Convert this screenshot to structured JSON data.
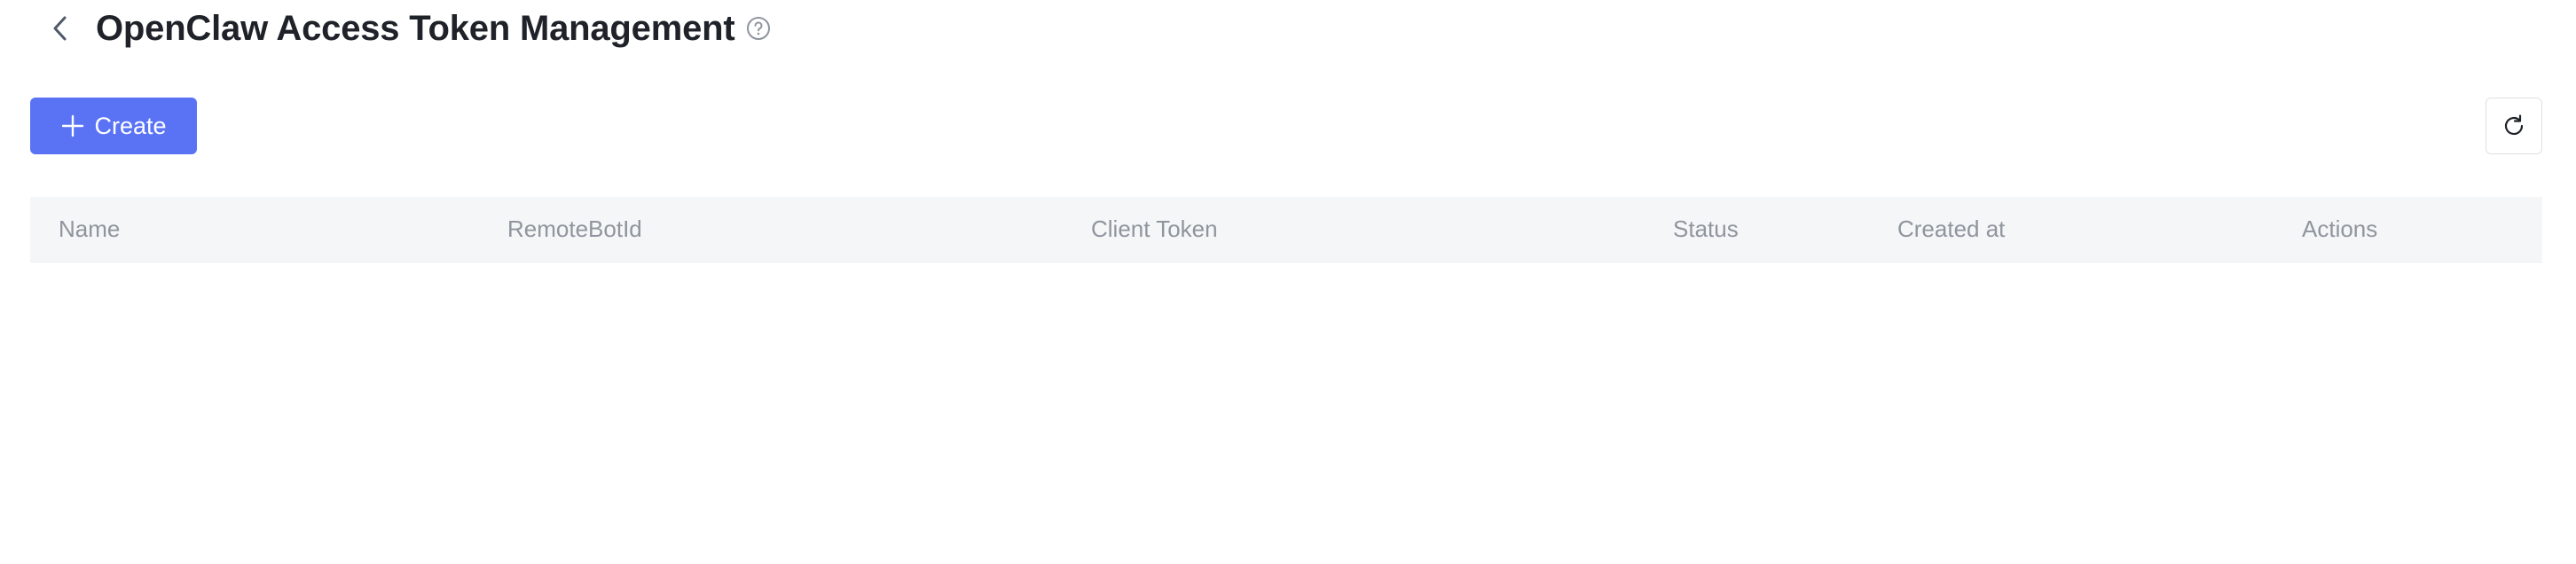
{
  "header": {
    "title": "OpenClaw Access Token Management",
    "back_icon": "chevron-left-icon",
    "help_icon": "question-circle-icon"
  },
  "toolbar": {
    "create_label": "Create",
    "create_icon": "plus-icon",
    "refresh_icon": "refresh-icon"
  },
  "table": {
    "columns": [
      "Name",
      "RemoteBotId",
      "Client Token",
      "Status",
      "Created at",
      "Actions"
    ],
    "rows": []
  },
  "colors": {
    "primary": "#5a73f5",
    "header_bg": "#f5f6f7",
    "header_text": "#8f959e",
    "title_text": "#1f2329"
  }
}
